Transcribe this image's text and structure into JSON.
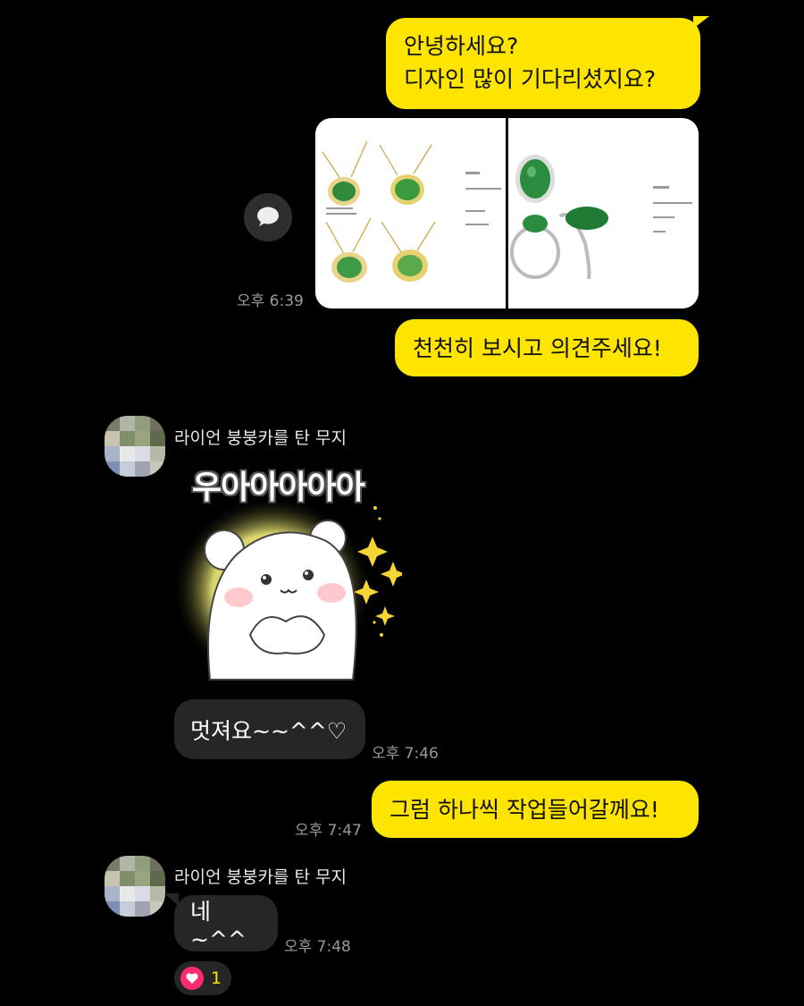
{
  "messages": {
    "m1_line1": "안녕하세요?",
    "m1_line2": "디자인 많이 기다리셨지요?",
    "img_time": "오후 6:39",
    "m2": "천천히 보시고 의견주세요!",
    "sender1": "라이언 붕붕카를 탄 무지",
    "sticker_text": "우아아아아아",
    "m3": "멋져요~~^^♡",
    "m3_time": "오후 7:46",
    "m4": "그럼 하나씩 작업들어갈께요!",
    "m4_time": "오후 7:47",
    "sender2": "라이언 붕붕카를 탄 무지",
    "m5": "네~^^",
    "m5_time": "오후 7:48",
    "reaction_count": "1"
  },
  "colors": {
    "my_bubble": "#fee500",
    "their_bubble": "#262626",
    "background": "#000000",
    "jade": "#2f8a3c",
    "heart": "#ff2b6e"
  },
  "icons": [
    "speech-bubble-icon",
    "heart-icon"
  ]
}
